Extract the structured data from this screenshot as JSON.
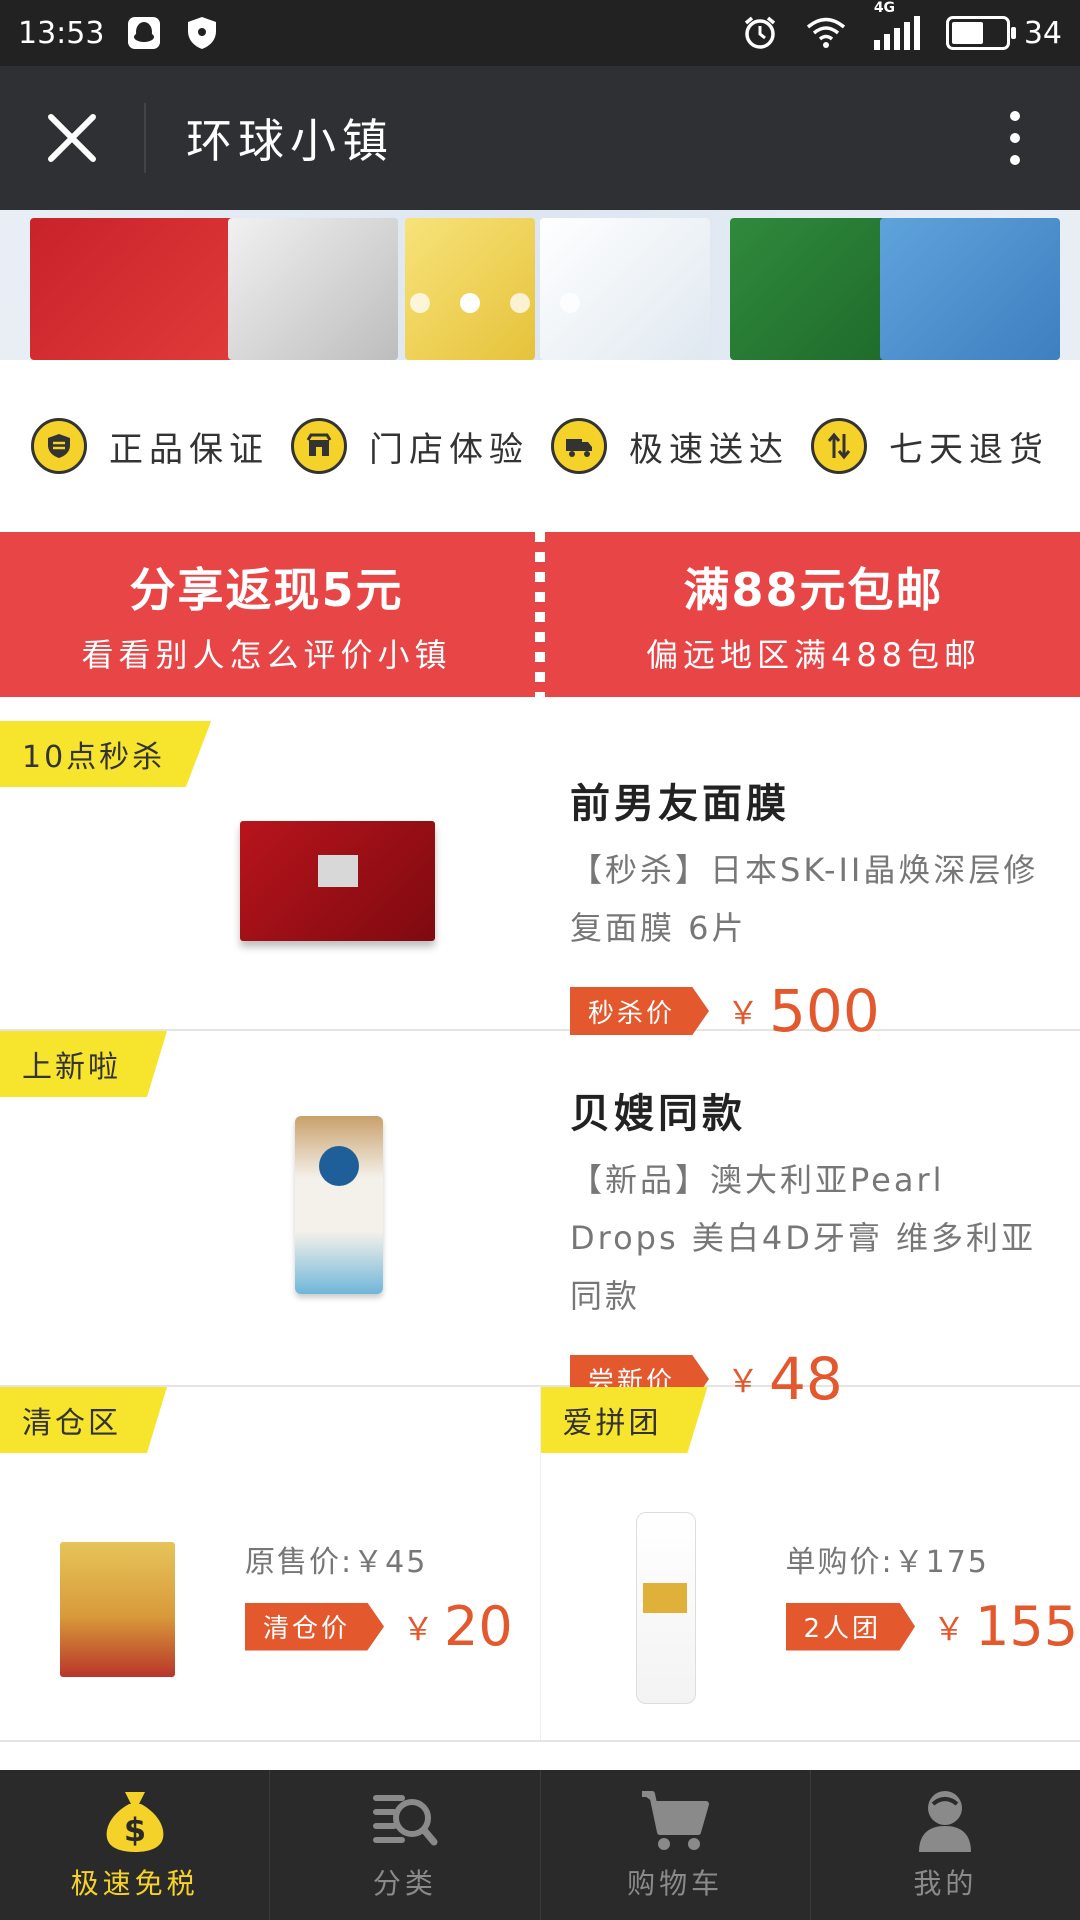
{
  "status_bar": {
    "time": "13:53",
    "network": "4G",
    "battery": "34",
    "battery_level": 0.6
  },
  "header": {
    "title": "环球小镇"
  },
  "features": [
    {
      "icon": "shield-icon",
      "label": "正品保证"
    },
    {
      "icon": "store-icon",
      "label": "门店体验"
    },
    {
      "icon": "truck-icon",
      "label": "极速送达"
    },
    {
      "icon": "return-icon",
      "label": "七天退货"
    }
  ],
  "promos": [
    {
      "title": "分享返现5元",
      "subtitle": "看看别人怎么评价小镇"
    },
    {
      "title": "满88元包邮",
      "subtitle": "偏远地区满488包邮"
    }
  ],
  "products": [
    {
      "tag": "10点秒杀",
      "name": "前男友面膜",
      "desc": "【秒杀】日本SK-II晶焕深层修复面膜 6片",
      "badge": "秒杀价",
      "currency": "￥",
      "price": "500"
    },
    {
      "tag": "上新啦",
      "name": "贝嫂同款",
      "desc": "【新品】澳大利亚Pearl Drops 美白4D牙膏 维多利亚同款",
      "badge": "尝新价",
      "currency": "￥",
      "price": "48"
    }
  ],
  "small_products": [
    {
      "tag": "清仓区",
      "orig": "原售价:￥45",
      "badge": "清仓价",
      "currency": "￥",
      "price": "20"
    },
    {
      "tag": "爱拼团",
      "orig": "单购价:￥175",
      "badge": "2人团",
      "currency": "￥",
      "price": "155"
    }
  ],
  "tabs": [
    {
      "icon": "money-bag-icon",
      "label": "极速免税",
      "active": true
    },
    {
      "icon": "category-search-icon",
      "label": "分类",
      "active": false
    },
    {
      "icon": "cart-icon",
      "label": "购物车",
      "active": false
    },
    {
      "icon": "user-icon",
      "label": "我的",
      "active": false
    }
  ],
  "colors": {
    "accent_red": "#e84547",
    "price_orange": "#e4582d",
    "tag_yellow": "#f7e42c",
    "active_tab": "#f5d22a",
    "inactive_tab": "#8a8a8a"
  }
}
